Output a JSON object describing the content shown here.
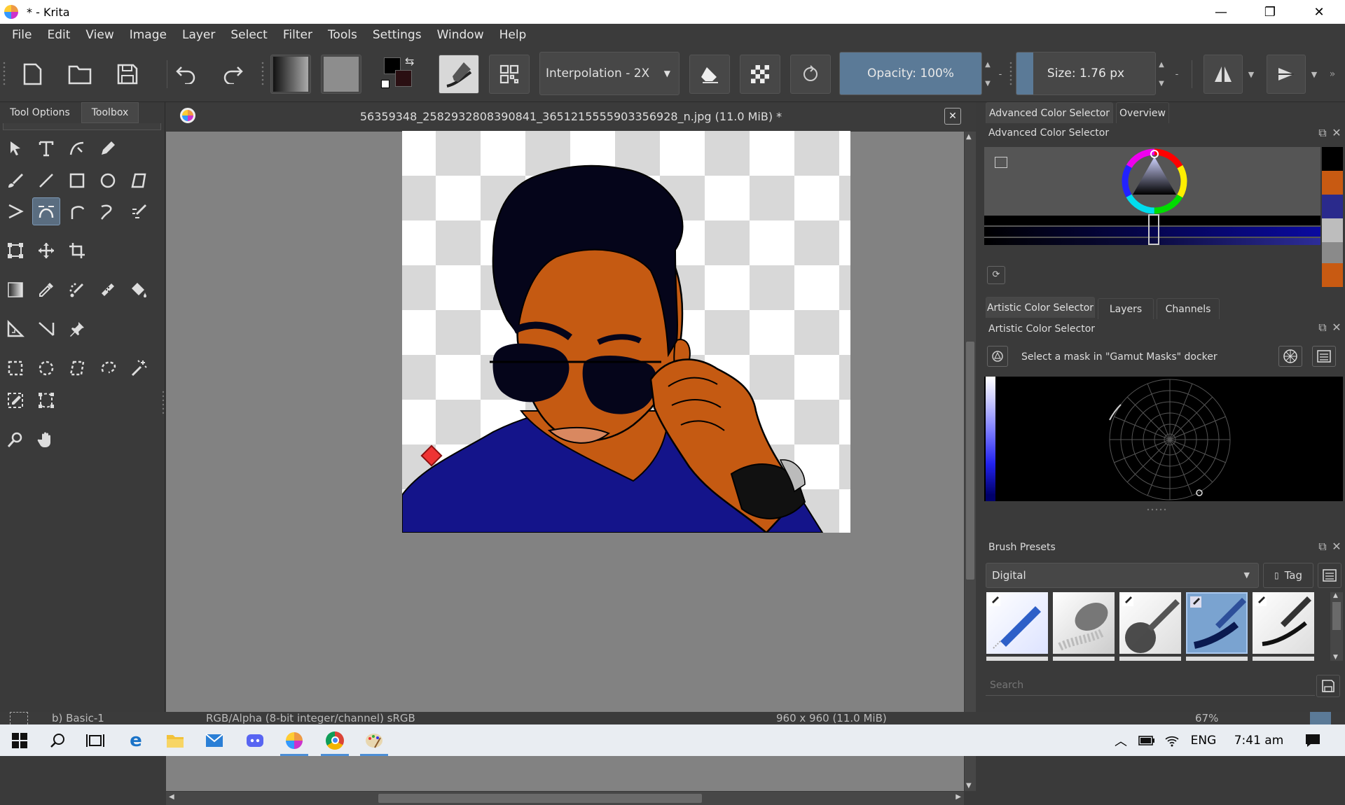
{
  "window": {
    "title": "* - Krita",
    "controls": {
      "minimize": "—",
      "restore": "❐",
      "close": "✕"
    }
  },
  "menu": [
    "File",
    "Edit",
    "View",
    "Image",
    "Layer",
    "Select",
    "Filter",
    "Tools",
    "Settings",
    "Window",
    "Help"
  ],
  "toolbar": {
    "interpolation": "Interpolation - 2X",
    "opacity": "Opacity: 100%",
    "size": "Size: 1.76 px",
    "foreground_color": "#000000",
    "background_color": "#2a0f12"
  },
  "left_tabs": [
    "Tool Options",
    "Toolbox"
  ],
  "active_left_tab": "Toolbox",
  "document": {
    "title": "56359348_2582932808390841_3651215555903356928_n.jpg (11.0 MiB) *"
  },
  "right": {
    "top_tabs": [
      "Advanced Color Selector",
      "Overview"
    ],
    "advanced_color_selector_title": "Advanced Color Selector",
    "palette_colors": [
      "#000000",
      "#c85a12",
      "#2a2a8c",
      "#bdbdbd",
      "#8a8a8a",
      "#c85a12"
    ],
    "mid_tabs": [
      "Artistic Color Selector",
      "Layers",
      "Channels"
    ],
    "artistic_color_selector_title": "Artistic Color Selector",
    "gamut_mask_hint": "Select a mask in \"Gamut Masks\" docker",
    "brush_presets_title": "Brush Presets",
    "brush_tag_filter": "Digital",
    "tag_button": "Tag",
    "search_placeholder": "Search"
  },
  "status": {
    "brush": "b) Basic-1",
    "color_model": "RGB/Alpha (8-bit integer/channel)  sRGB",
    "dimensions": "960 x 960 (11.0 MiB)",
    "zoom": "67%"
  },
  "taskbar": {
    "language": "ENG",
    "time": "7:41 am"
  }
}
